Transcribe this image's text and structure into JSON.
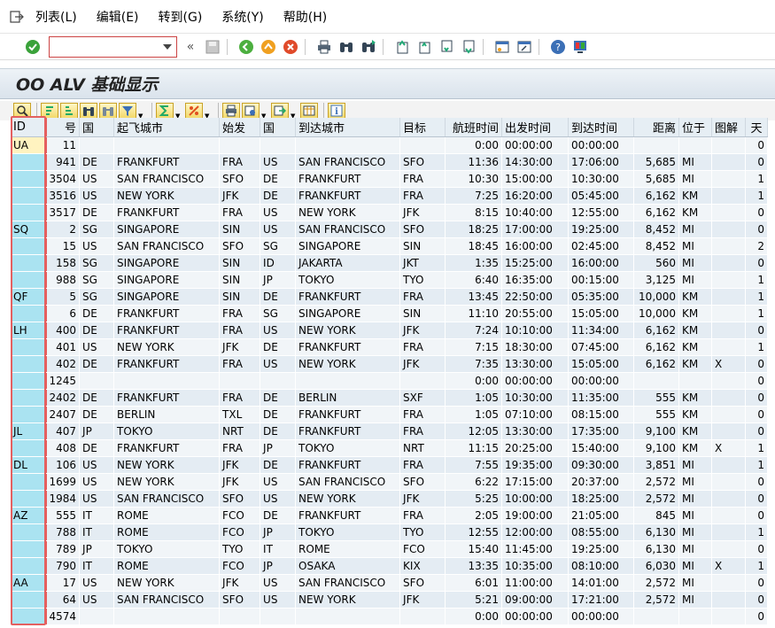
{
  "menu": {
    "items": [
      "列表(L)",
      "编辑(E)",
      "转到(G)",
      "系统(Y)",
      "帮助(H)"
    ]
  },
  "title": "OO ALV 基础显示",
  "grid": {
    "columns": [
      "ID",
      "号",
      "国",
      "起飞城市",
      "始发",
      "国",
      "到达城市",
      "目标",
      "航班时间",
      "出发时间",
      "到达时间",
      "距离",
      "位于",
      "图解",
      "天"
    ],
    "rows": [
      [
        "UA",
        "11",
        "",
        "",
        "",
        "",
        "",
        "",
        "0:00",
        "00:00:00",
        "00:00:00",
        "",
        "",
        "",
        "0"
      ],
      [
        "",
        "941",
        "DE",
        "FRANKFURT",
        "FRA",
        "US",
        "SAN FRANCISCO",
        "SFO",
        "11:36",
        "14:30:00",
        "17:06:00",
        "5,685",
        "MI",
        "",
        "0"
      ],
      [
        "",
        "3504",
        "US",
        "SAN FRANCISCO",
        "SFO",
        "DE",
        "FRANKFURT",
        "FRA",
        "10:30",
        "15:00:00",
        "10:30:00",
        "5,685",
        "MI",
        "",
        "1"
      ],
      [
        "",
        "3516",
        "US",
        "NEW YORK",
        "JFK",
        "DE",
        "FRANKFURT",
        "FRA",
        "7:25",
        "16:20:00",
        "05:45:00",
        "6,162",
        "KM",
        "",
        "1"
      ],
      [
        "",
        "3517",
        "DE",
        "FRANKFURT",
        "FRA",
        "US",
        "NEW YORK",
        "JFK",
        "8:15",
        "10:40:00",
        "12:55:00",
        "6,162",
        "KM",
        "",
        "0"
      ],
      [
        "SQ",
        "2",
        "SG",
        "SINGAPORE",
        "SIN",
        "US",
        "SAN FRANCISCO",
        "SFO",
        "18:25",
        "17:00:00",
        "19:25:00",
        "8,452",
        "MI",
        "",
        "0"
      ],
      [
        "",
        "15",
        "US",
        "SAN FRANCISCO",
        "SFO",
        "SG",
        "SINGAPORE",
        "SIN",
        "18:45",
        "16:00:00",
        "02:45:00",
        "8,452",
        "MI",
        "",
        "2"
      ],
      [
        "",
        "158",
        "SG",
        "SINGAPORE",
        "SIN",
        "ID",
        "JAKARTA",
        "JKT",
        "1:35",
        "15:25:00",
        "16:00:00",
        "560",
        "MI",
        "",
        "0"
      ],
      [
        "",
        "988",
        "SG",
        "SINGAPORE",
        "SIN",
        "JP",
        "TOKYO",
        "TYO",
        "6:40",
        "16:35:00",
        "00:15:00",
        "3,125",
        "MI",
        "",
        "1"
      ],
      [
        "QF",
        "5",
        "SG",
        "SINGAPORE",
        "SIN",
        "DE",
        "FRANKFURT",
        "FRA",
        "13:45",
        "22:50:00",
        "05:35:00",
        "10,000",
        "KM",
        "",
        "1"
      ],
      [
        "",
        "6",
        "DE",
        "FRANKFURT",
        "FRA",
        "SG",
        "SINGAPORE",
        "SIN",
        "11:10",
        "20:55:00",
        "15:05:00",
        "10,000",
        "KM",
        "",
        "1"
      ],
      [
        "LH",
        "400",
        "DE",
        "FRANKFURT",
        "FRA",
        "US",
        "NEW YORK",
        "JFK",
        "7:24",
        "10:10:00",
        "11:34:00",
        "6,162",
        "KM",
        "",
        "0"
      ],
      [
        "",
        "401",
        "US",
        "NEW YORK",
        "JFK",
        "DE",
        "FRANKFURT",
        "FRA",
        "7:15",
        "18:30:00",
        "07:45:00",
        "6,162",
        "KM",
        "",
        "1"
      ],
      [
        "",
        "402",
        "DE",
        "FRANKFURT",
        "FRA",
        "US",
        "NEW YORK",
        "JFK",
        "7:35",
        "13:30:00",
        "15:05:00",
        "6,162",
        "KM",
        "X",
        "0"
      ],
      [
        "",
        "1245",
        "",
        "",
        "",
        "",
        "",
        "",
        "0:00",
        "00:00:00",
        "00:00:00",
        "",
        "",
        "",
        "0"
      ],
      [
        "",
        "2402",
        "DE",
        "FRANKFURT",
        "FRA",
        "DE",
        "BERLIN",
        "SXF",
        "1:05",
        "10:30:00",
        "11:35:00",
        "555",
        "KM",
        "",
        "0"
      ],
      [
        "",
        "2407",
        "DE",
        "BERLIN",
        "TXL",
        "DE",
        "FRANKFURT",
        "FRA",
        "1:05",
        "07:10:00",
        "08:15:00",
        "555",
        "KM",
        "",
        "0"
      ],
      [
        "JL",
        "407",
        "JP",
        "TOKYO",
        "NRT",
        "DE",
        "FRANKFURT",
        "FRA",
        "12:05",
        "13:30:00",
        "17:35:00",
        "9,100",
        "KM",
        "",
        "0"
      ],
      [
        "",
        "408",
        "DE",
        "FRANKFURT",
        "FRA",
        "JP",
        "TOKYO",
        "NRT",
        "11:15",
        "20:25:00",
        "15:40:00",
        "9,100",
        "KM",
        "X",
        "1"
      ],
      [
        "DL",
        "106",
        "US",
        "NEW YORK",
        "JFK",
        "DE",
        "FRANKFURT",
        "FRA",
        "7:55",
        "19:35:00",
        "09:30:00",
        "3,851",
        "MI",
        "",
        "1"
      ],
      [
        "",
        "1699",
        "US",
        "NEW YORK",
        "JFK",
        "US",
        "SAN FRANCISCO",
        "SFO",
        "6:22",
        "17:15:00",
        "20:37:00",
        "2,572",
        "MI",
        "",
        "0"
      ],
      [
        "",
        "1984",
        "US",
        "SAN FRANCISCO",
        "SFO",
        "US",
        "NEW YORK",
        "JFK",
        "5:25",
        "10:00:00",
        "18:25:00",
        "2,572",
        "MI",
        "",
        "0"
      ],
      [
        "AZ",
        "555",
        "IT",
        "ROME",
        "FCO",
        "DE",
        "FRANKFURT",
        "FRA",
        "2:05",
        "19:00:00",
        "21:05:00",
        "845",
        "MI",
        "",
        "0"
      ],
      [
        "",
        "788",
        "IT",
        "ROME",
        "FCO",
        "JP",
        "TOKYO",
        "TYO",
        "12:55",
        "12:00:00",
        "08:55:00",
        "6,130",
        "MI",
        "",
        "1"
      ],
      [
        "",
        "789",
        "JP",
        "TOKYO",
        "TYO",
        "IT",
        "ROME",
        "FCO",
        "15:40",
        "11:45:00",
        "19:25:00",
        "6,130",
        "MI",
        "",
        "0"
      ],
      [
        "",
        "790",
        "IT",
        "ROME",
        "FCO",
        "JP",
        "OSAKA",
        "KIX",
        "13:35",
        "10:35:00",
        "08:10:00",
        "6,030",
        "MI",
        "X",
        "1"
      ],
      [
        "AA",
        "17",
        "US",
        "NEW YORK",
        "JFK",
        "US",
        "SAN FRANCISCO",
        "SFO",
        "6:01",
        "11:00:00",
        "14:01:00",
        "2,572",
        "MI",
        "",
        "0"
      ],
      [
        "",
        "64",
        "US",
        "SAN FRANCISCO",
        "SFO",
        "US",
        "NEW YORK",
        "JFK",
        "5:21",
        "09:00:00",
        "17:21:00",
        "2,572",
        "MI",
        "",
        "0"
      ],
      [
        "",
        "4574",
        "",
        "",
        "",
        "",
        "",
        "",
        "0:00",
        "00:00:00",
        "00:00:00",
        "",
        "",
        "",
        "0"
      ]
    ]
  },
  "colors": {
    "key_column": "#aae3f1",
    "highlight_border": "#e46060",
    "row_alt": "#e4ecf3"
  }
}
